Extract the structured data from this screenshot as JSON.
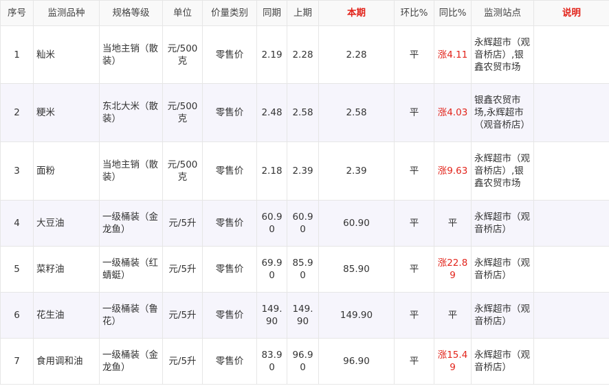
{
  "headers": [
    "序号",
    "监测品种",
    "规格等级",
    "单位",
    "价量类别",
    "同期",
    "上期",
    "本期",
    "环比%",
    "同比%",
    "监测站点",
    "说明"
  ],
  "rows": [
    {
      "no": "1",
      "item": "籼米",
      "spec": "当地主销（散装）",
      "unit": "元/500克",
      "type": "零售价",
      "same": "2.19",
      "prev": "2.28",
      "cur": "2.28",
      "mom": "平",
      "yoy": "涨4.11",
      "yoy_up": true,
      "site": "永辉超市（观音桥店）,银鑫农贸市场",
      "note": ""
    },
    {
      "no": "2",
      "item": "粳米",
      "spec": "东北大米（散装）",
      "unit": "元/500克",
      "type": "零售价",
      "same": "2.48",
      "prev": "2.58",
      "cur": "2.58",
      "mom": "平",
      "yoy": "涨4.03",
      "yoy_up": true,
      "site": "银鑫农贸市场,永辉超市（观音桥店）",
      "note": ""
    },
    {
      "no": "3",
      "item": "面粉",
      "spec": "当地主销（散装）",
      "unit": "元/500克",
      "type": "零售价",
      "same": "2.18",
      "prev": "2.39",
      "cur": "2.39",
      "mom": "平",
      "yoy": "涨9.63",
      "yoy_up": true,
      "site": "永辉超市（观音桥店）,银鑫农贸市场",
      "note": ""
    },
    {
      "no": "4",
      "item": "大豆油",
      "spec": "一级桶装（金龙鱼）",
      "unit": "元/5升",
      "type": "零售价",
      "same": "60.90",
      "prev": "60.90",
      "cur": "60.90",
      "mom": "平",
      "yoy": "平",
      "yoy_up": false,
      "site": "永辉超市（观音桥店）",
      "note": ""
    },
    {
      "no": "5",
      "item": "菜籽油",
      "spec": "一级桶装（红蜻蜓）",
      "unit": "元/5升",
      "type": "零售价",
      "same": "69.90",
      "prev": "85.90",
      "cur": "85.90",
      "mom": "平",
      "yoy": "涨22.89",
      "yoy_up": true,
      "site": "永辉超市（观音桥店）",
      "note": ""
    },
    {
      "no": "6",
      "item": "花生油",
      "spec": "一级桶装（鲁花）",
      "unit": "元/5升",
      "type": "零售价",
      "same": "149.90",
      "prev": "149.90",
      "cur": "149.90",
      "mom": "平",
      "yoy": "平",
      "yoy_up": false,
      "site": "永辉超市（观音桥店）",
      "note": ""
    },
    {
      "no": "7",
      "item": "食用调和油",
      "spec": "一级桶装（金龙鱼）",
      "unit": "元/5升",
      "type": "零售价",
      "same": "83.90",
      "prev": "96.90",
      "cur": "96.90",
      "mom": "平",
      "yoy": "涨15.49",
      "yoy_up": true,
      "site": "永辉超市（观音桥店）",
      "note": ""
    }
  ],
  "colors": {
    "up": "#e2231a",
    "even_row_bg": "#f6f5fc",
    "border": "#e6e6e6"
  }
}
